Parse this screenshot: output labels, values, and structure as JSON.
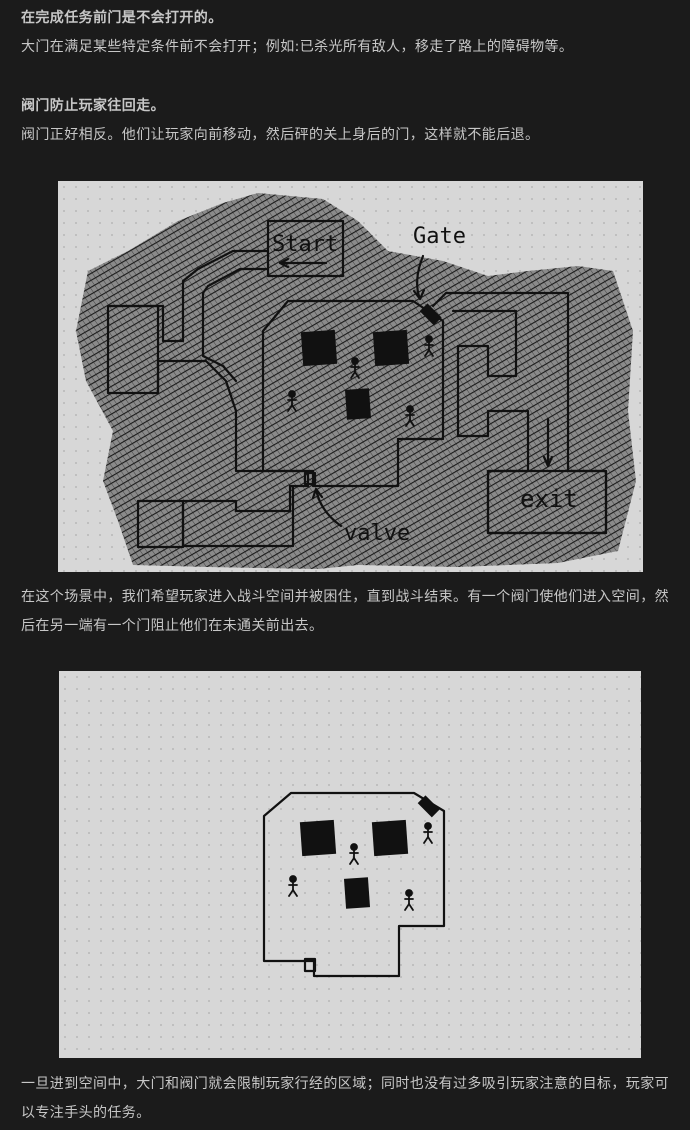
{
  "section1": {
    "heading": "在完成任务前门是不会打开的。",
    "body": "大门在满足某些特定条件前不会打开；例如:已杀光所有敌人，移走了路上的障碍物等。"
  },
  "section2": {
    "heading": "阀门防止玩家往回走。",
    "body": "阀门正好相反。他们让玩家向前移动，然后砰的关上身后的门，这样就不能后退。"
  },
  "figure1": {
    "label_start": "Start",
    "label_gate": "Gate",
    "label_exit": "exit",
    "label_valve": "valve"
  },
  "caption1": "在这个场景中，我们希望玩家进入战斗空间并被困住，直到战斗结束。有一个阀门使他们进入空间，然后在另一端有一个门阻止他们在未通关前出去。",
  "caption2": "一旦进到空间中，大门和阀门就会限制玩家行经的区域；同时也没有过多吸引玩家注意的目标，玩家可以专注手头的任务。"
}
